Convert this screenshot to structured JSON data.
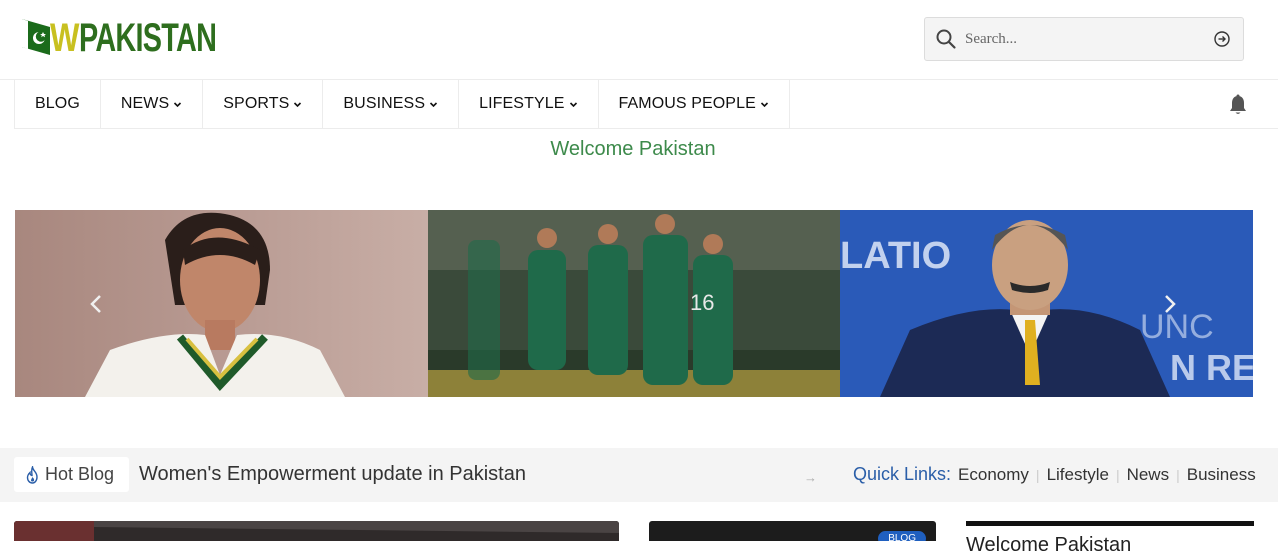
{
  "logo": {
    "w": "W",
    "rest": "PAKISTAN"
  },
  "search": {
    "placeholder": "Search..."
  },
  "nav": {
    "items": [
      {
        "label": "BLOG",
        "has_dropdown": false
      },
      {
        "label": "NEWS",
        "has_dropdown": true
      },
      {
        "label": "SPORTS",
        "has_dropdown": true
      },
      {
        "label": "BUSINESS",
        "has_dropdown": true
      },
      {
        "label": "LIFESTYLE",
        "has_dropdown": true
      },
      {
        "label": "FAMOUS PEOPLE",
        "has_dropdown": true
      }
    ]
  },
  "welcome": "Welcome Pakistan",
  "ticker": {
    "badge": "Hot Blog",
    "headline": "Women's Empowerment update in Pakistan",
    "quick_label": "Quick Links:",
    "links": [
      "Economy",
      "Lifestyle",
      "News",
      "Business"
    ]
  },
  "cards": {
    "badge": "BLOG",
    "title_partial": "Welcome Pakistan"
  },
  "colors": {
    "accent_green": "#3d8a4b",
    "link_blue": "#2a5ea8",
    "logo_green": "#2e6e1e",
    "logo_yellow": "#c8c020"
  }
}
